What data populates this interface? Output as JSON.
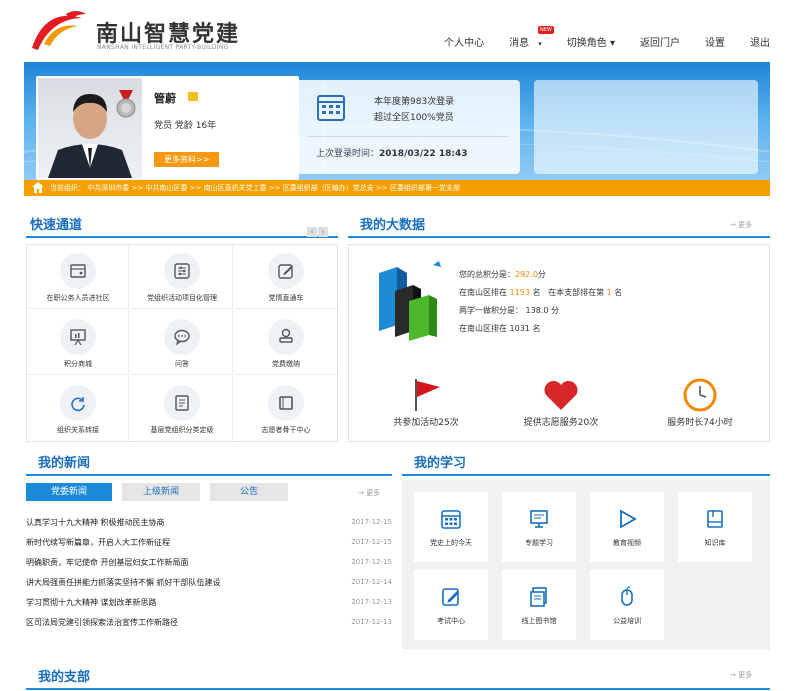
{
  "header": {
    "logo_title": "南山智慧党建",
    "logo_subtitle": "NANSHAN INTELLIGENT PARTY-BUILDING",
    "nav": [
      {
        "label": "个人中心"
      },
      {
        "label": "消息"
      },
      {
        "label": "切换角色 ▾"
      },
      {
        "label": "返回门户"
      },
      {
        "label": "设置"
      },
      {
        "label": "退出"
      }
    ],
    "message_badge": "NEW"
  },
  "profile": {
    "name": "管蔚",
    "info": "党员  党龄 16年",
    "more_label": "更多资料>>"
  },
  "login": {
    "line1": "本年度第983次登录",
    "line2": "超过全区100%党员",
    "last_login": "上次登录时间：",
    "last_login_value": "2018/03/22 18:43"
  },
  "breadcrumb": "当前组织：  中共深圳市委 >> 中共南山区委 >> 南山区直机关党工委 >> 区委组织部（区编办）党总支 >> 区委组织部第一党支部",
  "quick": {
    "title": "快速通道",
    "items": [
      {
        "label": "在职公务人员进社区",
        "icon": "card-icon"
      },
      {
        "label": "党组织活动项目化管理",
        "icon": "settings-list-icon"
      },
      {
        "label": "党情直通车",
        "icon": "edit-icon"
      },
      {
        "label": "积分商城",
        "icon": "presentation-icon"
      },
      {
        "label": "问答",
        "icon": "chat-icon"
      },
      {
        "label": "党费缴纳",
        "icon": "stamp-icon"
      },
      {
        "label": "组织关系转接",
        "icon": "refresh-icon"
      },
      {
        "label": "基层党组织分类定级",
        "icon": "document-icon"
      },
      {
        "label": "志愿者骨干中心",
        "icon": "window-icon"
      }
    ]
  },
  "bigdata": {
    "title": "我的大数据",
    "more": "→ 更多",
    "total_label": "您的总积分是：",
    "total_value": "292.0",
    "total_unit": "分",
    "rank_district_label": "在南山区排在",
    "rank_district_value": "1153",
    "rank_district_unit": "名",
    "rank_branch_label": "在本支部排在第",
    "rank_branch_value": "1",
    "rank_branch_unit": "名",
    "twostudy_label": "两学一做积分是：",
    "twostudy_value": "138.0 分",
    "twostudy_rank": "在南山区排在  1031  名",
    "stats": [
      {
        "label": "共参加活动25次",
        "icon": "flag-icon"
      },
      {
        "label": "提供志愿服务20次",
        "icon": "heart-icon"
      },
      {
        "label": "服务时长74小时",
        "icon": "clock-icon"
      }
    ]
  },
  "news": {
    "title": "我的新闻",
    "more": "→ 更多",
    "tabs": [
      "党委新闻",
      "上级新闻",
      "公告"
    ],
    "items": [
      {
        "title": "认真学习十九大精神 积极推动民主协商",
        "date": "2017-12-15"
      },
      {
        "title": "新时代续写新篇章，开启人大工作新征程",
        "date": "2017-12-15"
      },
      {
        "title": "明确职责，牢记使命 开创基层妇女工作新局面",
        "date": "2017-12-15"
      },
      {
        "title": "讲大局强责任拼能力抓落实坚持不懈 抓好干部队伍建设",
        "date": "2017-12-14"
      },
      {
        "title": "学习贯彻十九大精神 谋划改革新思路",
        "date": "2017-12-13"
      },
      {
        "title": "区司法局党建引领探索法治宣传工作新路径",
        "date": "2017-12-13"
      }
    ]
  },
  "learning": {
    "title": "我的学习",
    "items": [
      {
        "label": "党史上的今天",
        "icon": "calendar-grid-icon"
      },
      {
        "label": "专题学习",
        "icon": "screen-icon"
      },
      {
        "label": "教育视频",
        "icon": "play-icon"
      },
      {
        "label": "知识库",
        "icon": "book-icon"
      },
      {
        "label": "考试中心",
        "icon": "exam-edit-icon"
      },
      {
        "label": "线上图书馆",
        "icon": "library-icon"
      },
      {
        "label": "公益培训",
        "icon": "mouse-icon"
      }
    ]
  },
  "branch": {
    "title": "我的支部",
    "more": "→ 更多"
  },
  "colors": {
    "accent": "#1a8ad9",
    "orange": "#f5a000",
    "title_blue": "#1a6fbf"
  }
}
